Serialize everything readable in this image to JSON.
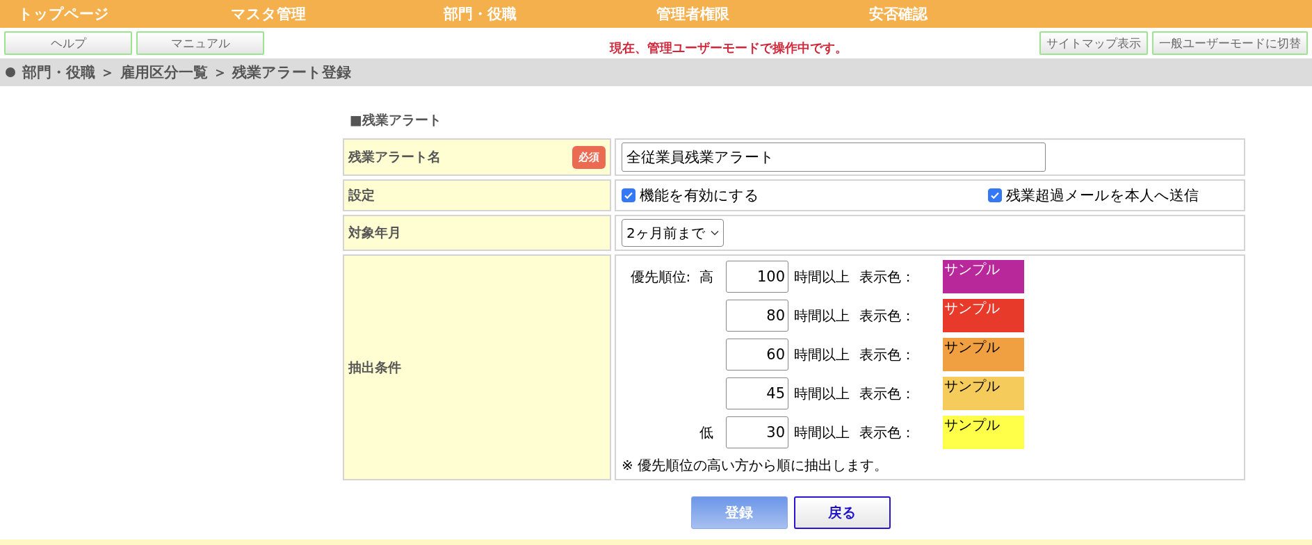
{
  "nav": {
    "items": [
      "トップページ",
      "マスタ管理",
      "部門・役職",
      "管理者権限",
      "安否確認"
    ]
  },
  "toolbar": {
    "left_buttons": [
      "ヘルプ",
      "マニュアル"
    ],
    "mode_notice": "現在、管理ユーザーモードで操作中です。",
    "right_buttons": [
      "サイトマップ表示",
      "一般ユーザーモードに切替"
    ]
  },
  "breadcrumb": "部門・役職 ＞ 雇用区分一覧 ＞ 残業アラート登録",
  "section_title": "■残業アラート",
  "form": {
    "name": {
      "label": "残業アラート名",
      "required_badge": "必須",
      "value": "全従業員残業アラート"
    },
    "settings": {
      "label": "設定",
      "options": [
        {
          "label": "機能を有効にする",
          "checked": true
        },
        {
          "label": "残業超過メールを本人へ送信",
          "checked": true
        }
      ]
    },
    "period": {
      "label": "対象年月",
      "value": "2ヶ月前まで"
    },
    "conditions": {
      "label": "抽出条件",
      "rows": [
        {
          "priority": "優先順位:  高",
          "hours": "100",
          "unit": "時間以上",
          "color_label": "表示色：",
          "sample": "サンプル",
          "color": "#b8289a"
        },
        {
          "hours": "80",
          "unit": "時間以上",
          "color_label": "表示色：",
          "sample": "サンプル",
          "color": "#e83a2b"
        },
        {
          "hours": "60",
          "unit": "時間以上",
          "color_label": "表示色：",
          "sample": "サンプル",
          "color": "#f0a040"
        },
        {
          "hours": "45",
          "unit": "時間以上",
          "color_label": "表示色：",
          "sample": "サンプル",
          "color": "#f5cc5c"
        },
        {
          "priority": "低",
          "hours": "30",
          "unit": "時間以上",
          "color_label": "表示色：",
          "sample": "サンプル",
          "color": "#ffff4a"
        }
      ],
      "note": "※ 優先順位の高い方から順に抽出します。"
    }
  },
  "actions": [
    {
      "label": "登録",
      "kind": "primary"
    },
    {
      "label": "戻る",
      "kind": "secondary"
    }
  ]
}
